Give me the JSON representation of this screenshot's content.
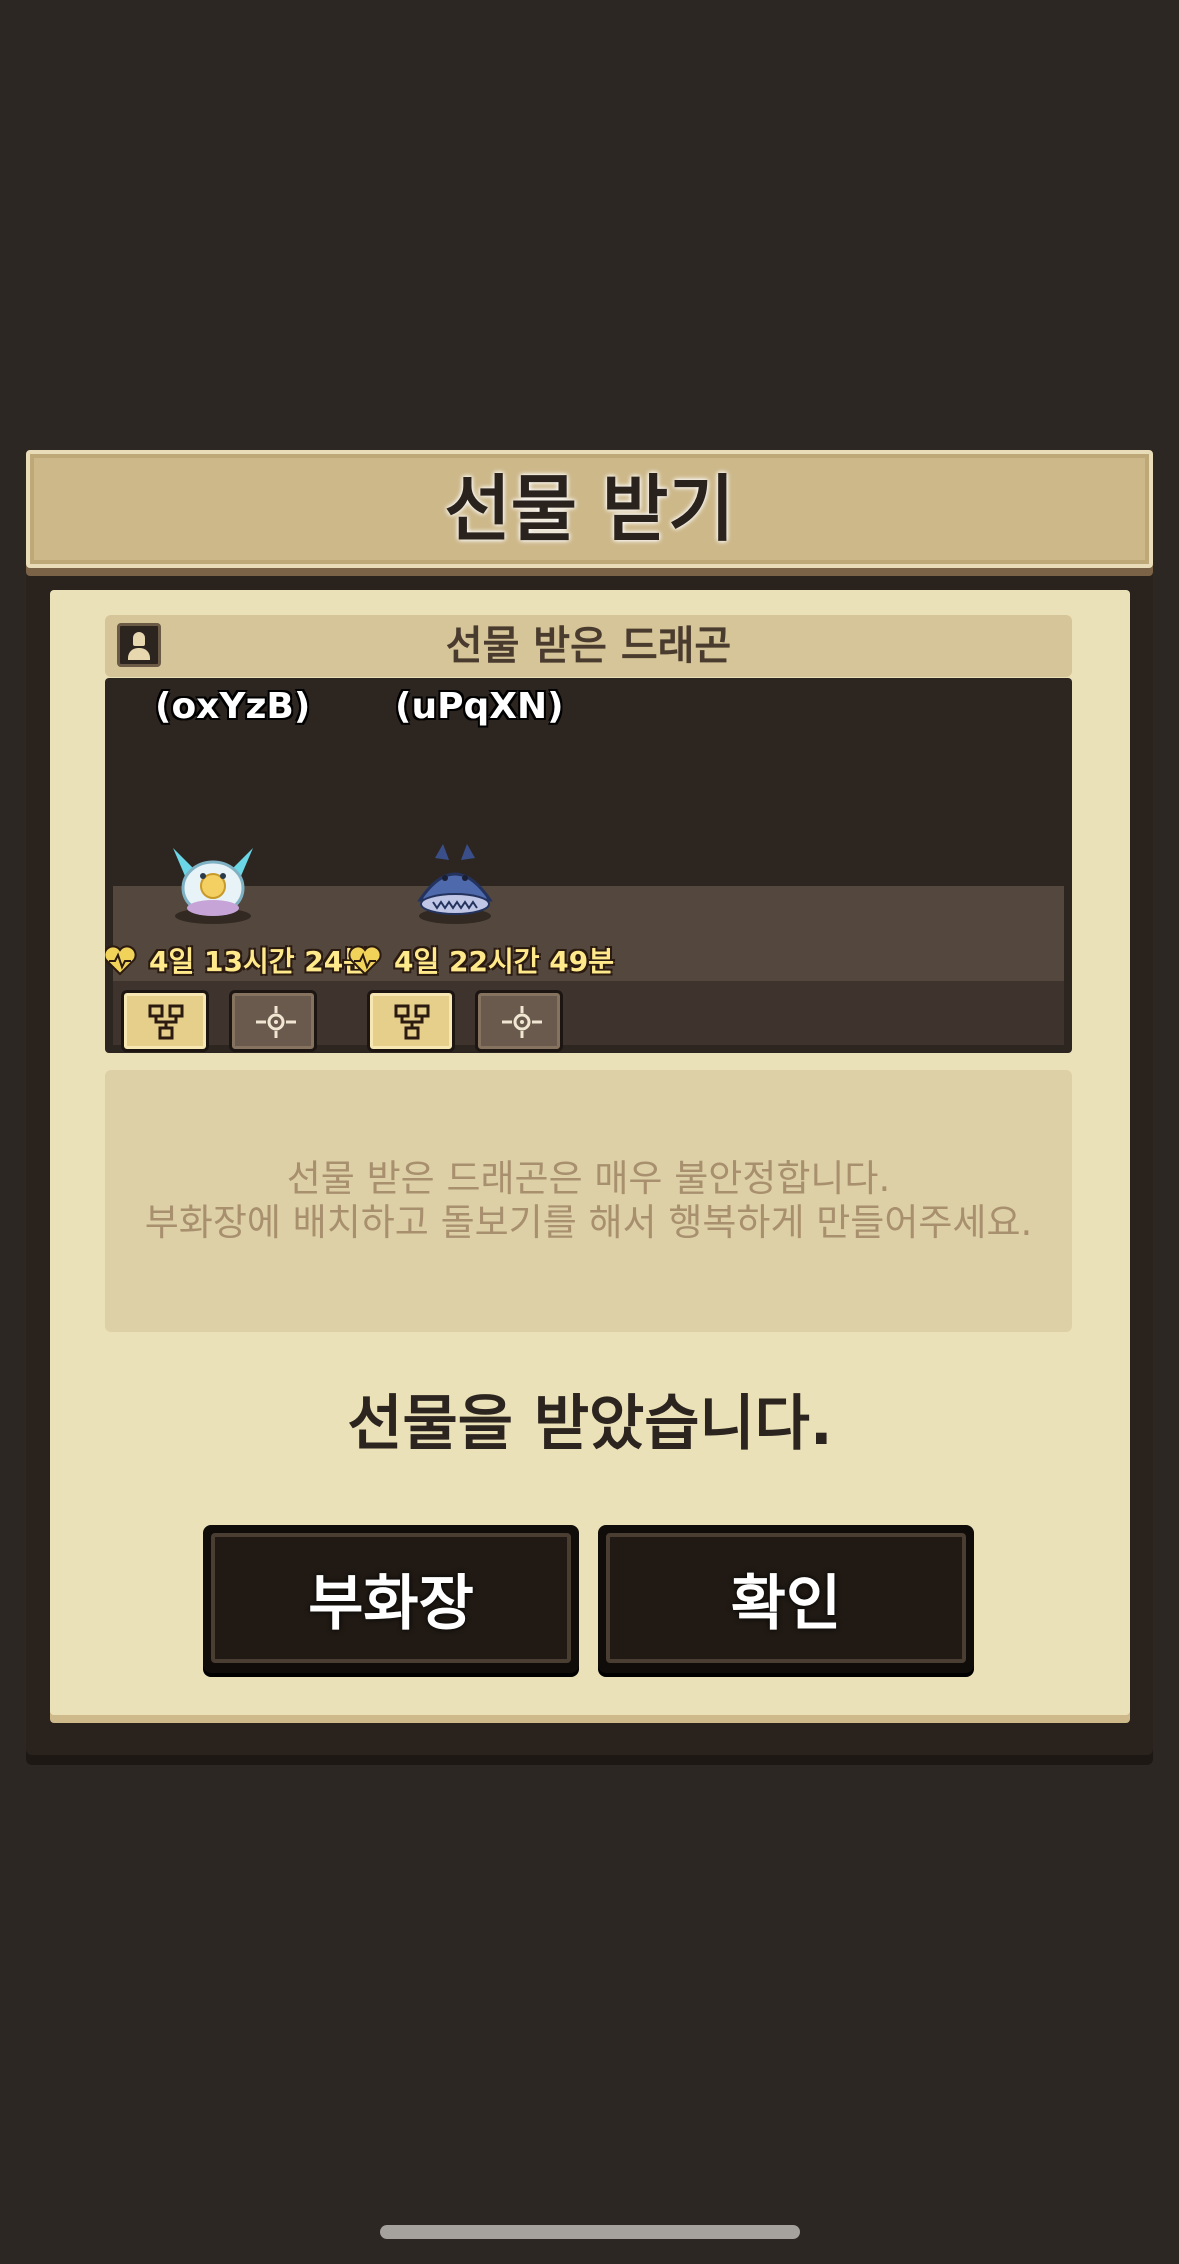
{
  "dialog": {
    "title": "선물 받기",
    "section_header": "선물 받은 드래곤",
    "dragons": [
      {
        "name": "(oxYzB)",
        "timer": "4일 13시간 24분"
      },
      {
        "name": "(uPqXN)",
        "timer": "4일 22시간 49분"
      }
    ],
    "notice_lines": [
      "선물 받은 드래곤은 매우 불안정합니다.",
      "부화장에 배치하고 돌보기를 해서 행복하게 만들어주세요."
    ],
    "received_message": "선물을 받았습니다.",
    "buttons": {
      "hatchery": "부화장",
      "confirm": "확인"
    }
  },
  "colors": {
    "background": "#2d2724",
    "panel": "#ebe1b8",
    "title_bar": "#cdb88a",
    "timer_text": "#ffe98a",
    "heart": "#f1d35a"
  },
  "icons": [
    "user-avatar-icon",
    "heart-pulse-icon",
    "family-tree-icon",
    "gear-compass-icon"
  ]
}
